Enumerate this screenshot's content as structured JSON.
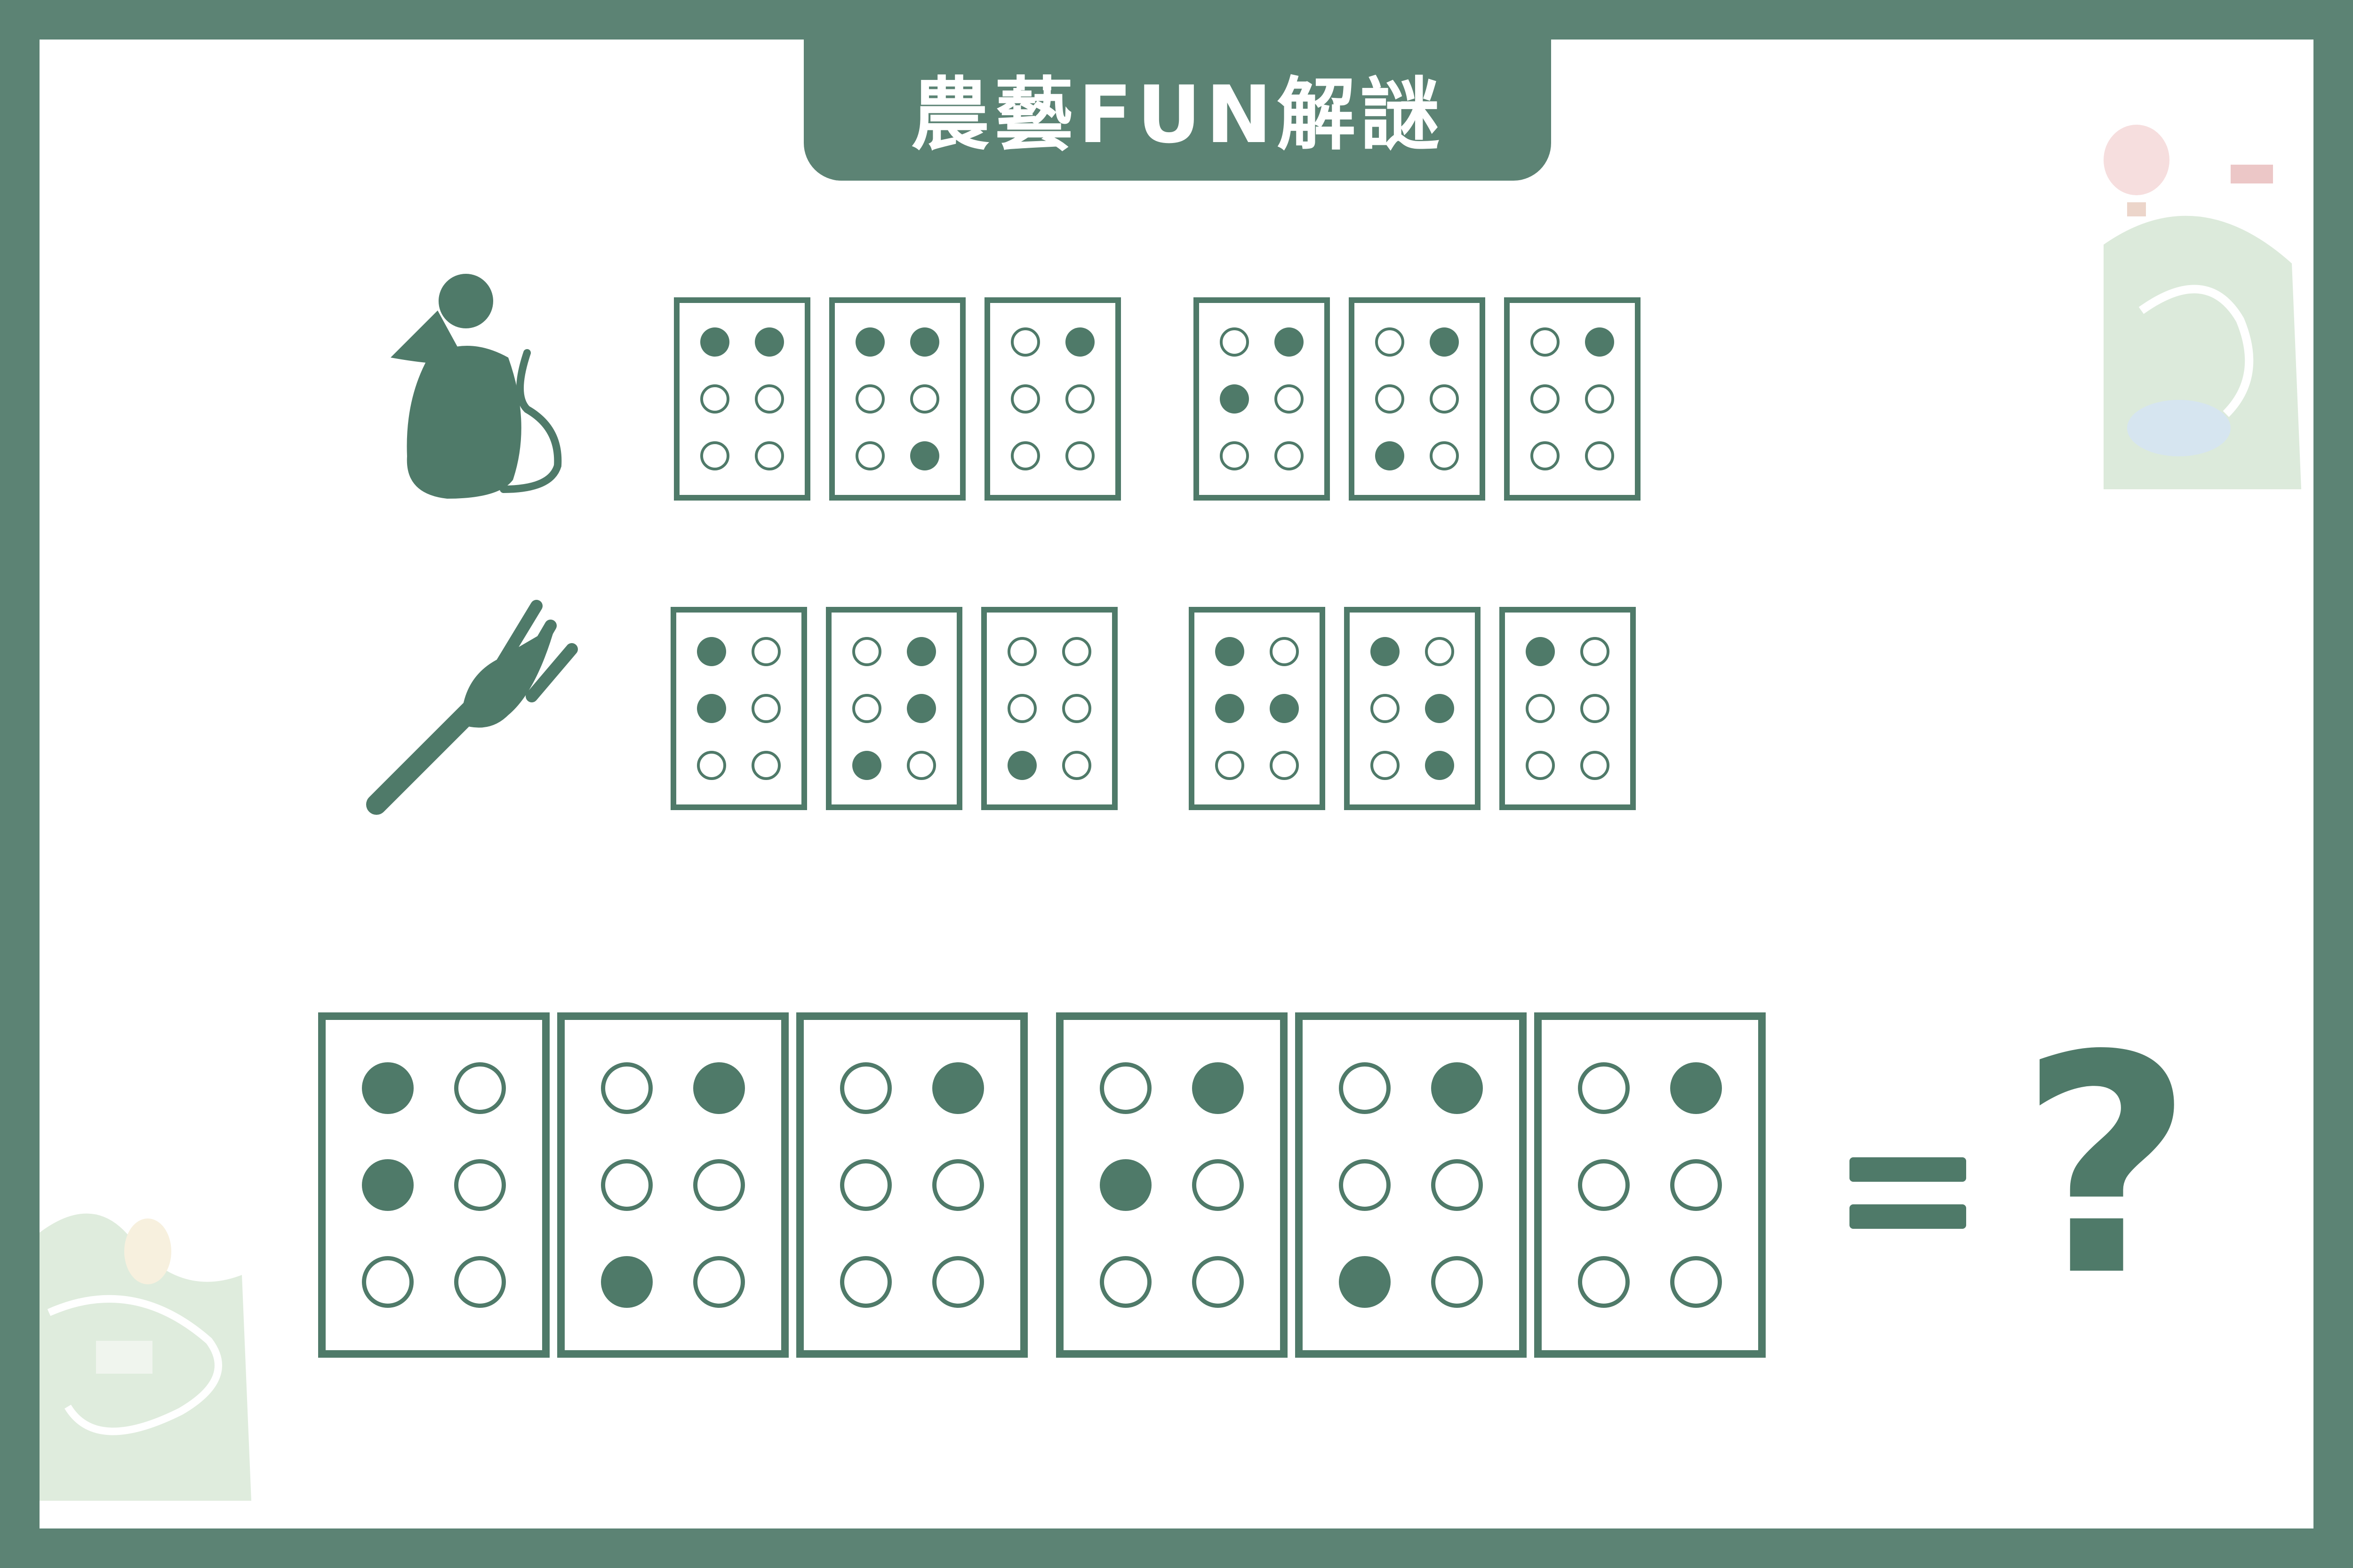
{
  "title": "農藝FUN解謎",
  "colors": {
    "frame": "#5c8374",
    "ink": "#4f7a69",
    "background": "#ffffff"
  },
  "icons": [
    "mouse-icon",
    "fork-icon",
    "balloon-decoration",
    "farm-landscape-decoration"
  ],
  "rows": [
    {
      "icon": "mouse-icon",
      "words": [
        [
          [
            1,
            1,
            0,
            0,
            0,
            0
          ],
          [
            1,
            1,
            0,
            0,
            0,
            1
          ],
          [
            0,
            1,
            0,
            0,
            0,
            0
          ]
        ],
        [
          [
            0,
            1,
            1,
            0,
            0,
            0
          ],
          [
            0,
            1,
            0,
            0,
            1,
            0
          ],
          [
            0,
            1,
            0,
            0,
            0,
            0
          ]
        ]
      ]
    },
    {
      "icon": "fork-icon",
      "words": [
        [
          [
            1,
            0,
            1,
            0,
            0,
            0
          ],
          [
            0,
            1,
            0,
            1,
            1,
            0
          ],
          [
            0,
            0,
            0,
            0,
            1,
            0
          ]
        ],
        [
          [
            1,
            0,
            1,
            1,
            0,
            0
          ],
          [
            1,
            0,
            0,
            1,
            0,
            1
          ],
          [
            1,
            0,
            0,
            0,
            0,
            0
          ]
        ]
      ]
    }
  ],
  "question": {
    "words": [
      [
        [
          1,
          0,
          1,
          0,
          0,
          0
        ],
        [
          0,
          1,
          0,
          0,
          1,
          0
        ],
        [
          0,
          1,
          0,
          0,
          0,
          0
        ]
      ],
      [
        [
          0,
          1,
          1,
          0,
          0,
          0
        ],
        [
          0,
          1,
          0,
          0,
          1,
          0
        ],
        [
          0,
          1,
          0,
          0,
          0,
          0
        ]
      ]
    ],
    "equals": "=",
    "mark": "?"
  }
}
